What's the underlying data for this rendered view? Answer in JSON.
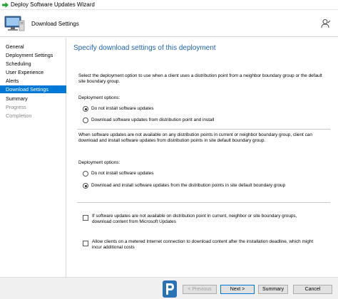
{
  "window": {
    "title": "Deploy Software Updates Wizard"
  },
  "header": {
    "title": "Download Settings"
  },
  "nav": {
    "items": [
      {
        "label": "General",
        "state": "normal"
      },
      {
        "label": "Deployment Settings",
        "state": "normal"
      },
      {
        "label": "Scheduling",
        "state": "normal"
      },
      {
        "label": "User Experience",
        "state": "normal"
      },
      {
        "label": "Alerts",
        "state": "normal"
      },
      {
        "label": "Download Settings",
        "state": "active"
      },
      {
        "label": "Summary",
        "state": "normal"
      },
      {
        "label": "Progress",
        "state": "disabled"
      },
      {
        "label": "Completion",
        "state": "disabled"
      }
    ]
  },
  "main": {
    "heading": "Specify download settings of this deployment",
    "section1": {
      "description": "Select the deployment option to use when a client uses a distribution point from a neighbor boundary group or the default site boundary group.",
      "options_label": "Deployment options:",
      "options": [
        {
          "label": "Do not install software updates",
          "selected": true
        },
        {
          "label": "Download software updates from distribution point and install",
          "selected": false
        }
      ]
    },
    "section2": {
      "description": "When software updates are not available on any distribution points in current or neighbor boundary group, client can download and install software updates from distribution points in site default boundary group.",
      "options_label": "Deployment options:",
      "options": [
        {
          "label": "Do not install software updates",
          "selected": false
        },
        {
          "label": "Download and install software updates from the distribution points in site default boundary group",
          "selected": true
        }
      ]
    },
    "checkboxes": [
      {
        "label": "If software updates are not available on distribution point in current, neighbor or site boundary groups, download content from Microsoft Updates",
        "checked": false
      },
      {
        "label": "Allow clients on a metered Internet connection to download content after the installation deadline, which might incur additional costs",
        "checked": false
      }
    ]
  },
  "footer": {
    "previous": "< Previous",
    "next": "Next >",
    "summary": "Summary",
    "cancel": "Cancel"
  },
  "colors": {
    "accent": "#0078d7",
    "heading": "#1e63b7"
  }
}
